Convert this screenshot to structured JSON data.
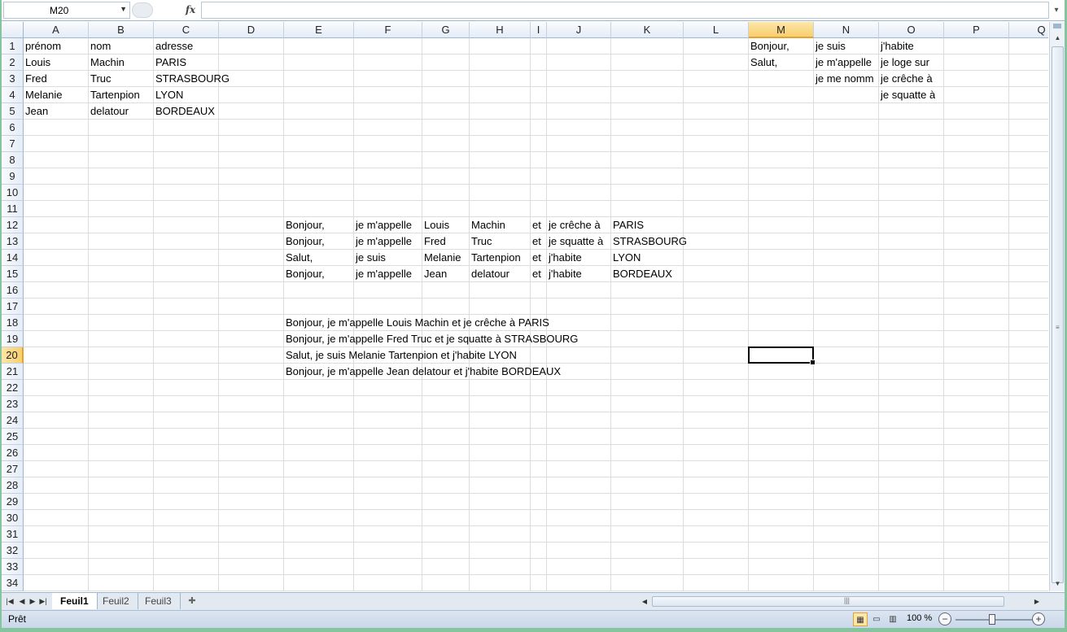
{
  "formula_bar": {
    "name_box": "M20",
    "fx_label": "fx",
    "formula": ""
  },
  "columns": [
    "A",
    "B",
    "C",
    "D",
    "E",
    "F",
    "G",
    "H",
    "I",
    "J",
    "K",
    "L",
    "M",
    "N",
    "O",
    "P",
    "Q"
  ],
  "active_column": "M",
  "rows": [
    "1",
    "2",
    "3",
    "4",
    "5",
    "6",
    "7",
    "8",
    "9",
    "10",
    "11",
    "12",
    "13",
    "14",
    "15",
    "16",
    "17",
    "18",
    "19",
    "20",
    "21",
    "22",
    "23",
    "24",
    "25",
    "26",
    "27",
    "28",
    "29",
    "30",
    "31",
    "32",
    "33",
    "34"
  ],
  "active_row": "20",
  "cells": {
    "A1": "prénom",
    "B1": "nom",
    "C1": "adresse",
    "A2": "Louis",
    "B2": "Machin",
    "C2": "PARIS",
    "A3": "Fred",
    "B3": "Truc",
    "C3": "STRASBOURG",
    "A4": "Melanie",
    "B4": "Tartenpion",
    "C4": "LYON",
    "A5": "Jean",
    "B5": "delatour",
    "C5": "BORDEAUX",
    "M1": "Bonjour,",
    "N1": "je suis",
    "O1": "j'habite",
    "M2": "Salut,",
    "N2": "je m'appelle",
    "O2": "je loge sur",
    "N3": "je me nomm",
    "O3": "je crêche à",
    "O4": "je squatte à",
    "E12": "Bonjour,",
    "F12": "je m'appelle",
    "G12": "Louis",
    "H12": "Machin",
    "I12": "et",
    "J12": "je crêche à",
    "K12": "PARIS",
    "E13": "Bonjour,",
    "F13": "je m'appelle",
    "G13": "Fred",
    "H13": "Truc",
    "I13": "et",
    "J13": "je squatte à",
    "K13": "STRASBOURG",
    "E14": "Salut,",
    "F14": "je suis",
    "G14": "Melanie",
    "H14": "Tartenpion",
    "I14": "et",
    "J14": "j'habite",
    "K14": "LYON",
    "E15": "Bonjour,",
    "F15": "je m'appelle",
    "G15": "Jean",
    "H15": "delatour",
    "I15": "et",
    "J15": "j'habite",
    "K15": "BORDEAUX",
    "E18": "Bonjour, je m'appelle Louis Machin et je crêche à PARIS",
    "E19": "Bonjour, je m'appelle Fred Truc et je squatte à STRASBOURG",
    "E20": "Salut, je suis Melanie Tartenpion et j'habite LYON",
    "E21": "Bonjour, je m'appelle Jean delatour et j'habite BORDEAUX"
  },
  "sheet_tabs": [
    "Feuil1",
    "Feuil2",
    "Feuil3"
  ],
  "active_sheet": "Feuil1",
  "status": {
    "text": "Prêt",
    "zoom": "100 %"
  }
}
